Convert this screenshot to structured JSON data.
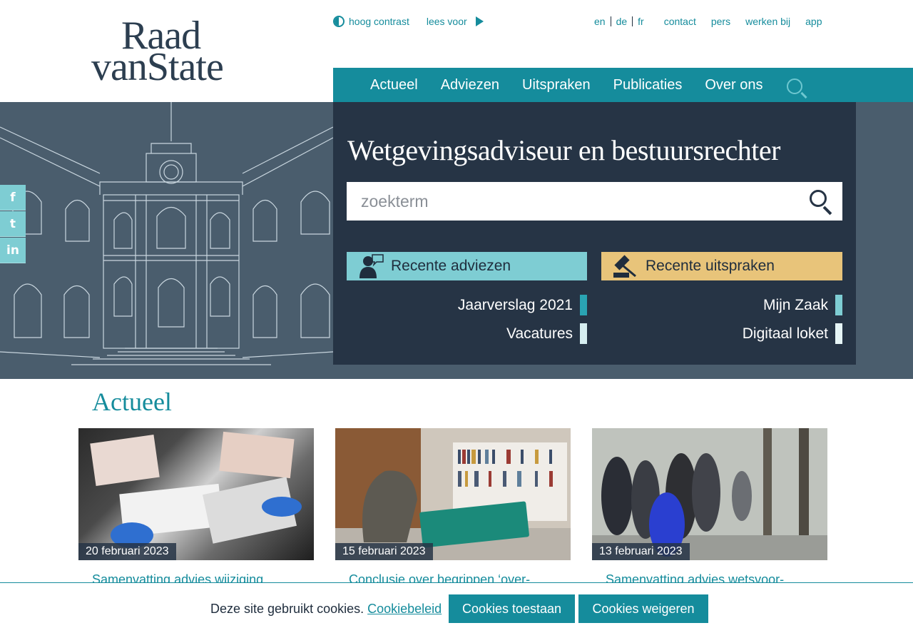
{
  "logo": {
    "line1": "Raad",
    "line2": "vanState"
  },
  "utility": {
    "contrast_label": "hoog contrast",
    "read_label": "lees voor",
    "languages": [
      "en",
      "de",
      "fr"
    ],
    "links": [
      "contact",
      "pers",
      "werken bij",
      "app"
    ]
  },
  "nav": {
    "items": [
      "Actueel",
      "Adviezen",
      "Uitspraken",
      "Publicaties",
      "Over ons"
    ]
  },
  "hero": {
    "title": "Wetgevingsadviseur en bestuursrechter",
    "search_placeholder": "zoekterm",
    "btn_adviezen": "Recente adviezen",
    "btn_uitspraken": "Recente uitspraken",
    "links_left": [
      "Jaarverslag 2021",
      "Vacatures"
    ],
    "links_right": [
      "Mijn Zaak",
      "Digitaal loket"
    ]
  },
  "social": [
    "f",
    "t",
    "in"
  ],
  "news": {
    "title": "Actueel",
    "cards": [
      {
        "date": "20 februari 2023",
        "title": "Samenvatting advies wijziging"
      },
      {
        "date": "15 februari 2023",
        "title": "Conclusie over begrippen ‘over-"
      },
      {
        "date": "13 februari 2023",
        "title": "Samenvatting advies wetsvoor-"
      }
    ]
  },
  "cookie": {
    "text": "Deze site gebruikt cookies.",
    "policy": "Cookiebeleid",
    "accept": "Cookies toestaan",
    "decline": "Cookies weigeren"
  },
  "colors": {
    "teal": "#158c9c",
    "navy": "#263445",
    "light_teal": "#7ecdd3",
    "gold": "#e8c47a",
    "slate": "#4a5d6d"
  }
}
